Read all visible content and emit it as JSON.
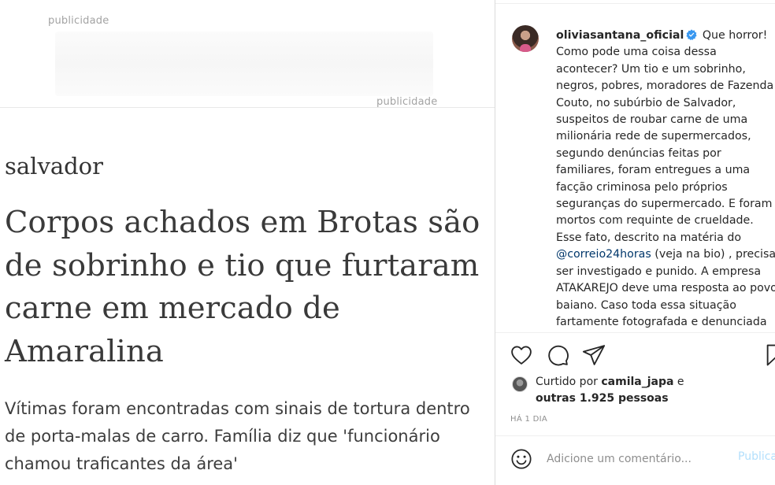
{
  "article": {
    "ad_label_top": "publicidade",
    "ad_label_bottom": "publicidade",
    "section": "salvador",
    "headline": "Corpos achados em Brotas são de sobrinho e tio que furtaram carne em mercado de Amaralina",
    "lead": "Vítimas foram encontradas com sinais de tortura dentro de porta-malas de carro. Família diz que 'funcionário chamou traficantes da área'"
  },
  "post": {
    "username": "oliviasantana_oficial",
    "caption_part1": "Que horror! Como pode uma coisa dessa acontecer? Um tio e um sobrinho, negros, pobres, moradores de Fazenda Couto, no subúrbio de Salvador, suspeitos de roubar carne de uma milionária rede de supermercados, segundo denúncias feitas por familiares, foram entregues a uma facção criminosa pelo próprios seguranças do supermercado. E foram mortos com requinte de crueldade. Esse fato, descrito na matéria do",
    "mention": "@correio24horas",
    "caption_part2": "(veja na bio) , precisa ser investigado e punido. A empresa ATAKAREJO deve uma resposta ao povo baiano. Caso toda essa situação fartamente fotografada e denunciada nas redes sociais e na",
    "likes_prefix": "Curtido por",
    "liked_by_user": "camila_japa",
    "likes_and": "e",
    "likes_others": "outras 1.925 pessoas",
    "timestamp": "HÁ 1 DIA",
    "comment_placeholder": "Adicione um comentário...",
    "publish_label": "Publicar"
  },
  "colors": {
    "verified_blue": "#3897f0",
    "mention_blue": "#00376b",
    "publish_disabled": "#b2dffc",
    "muted_gray": "#8e8e8e"
  },
  "icons": {
    "like": "heart-outline",
    "comment": "speech-bubble",
    "share": "paper-plane",
    "save": "bookmark",
    "emoji": "smiley"
  }
}
